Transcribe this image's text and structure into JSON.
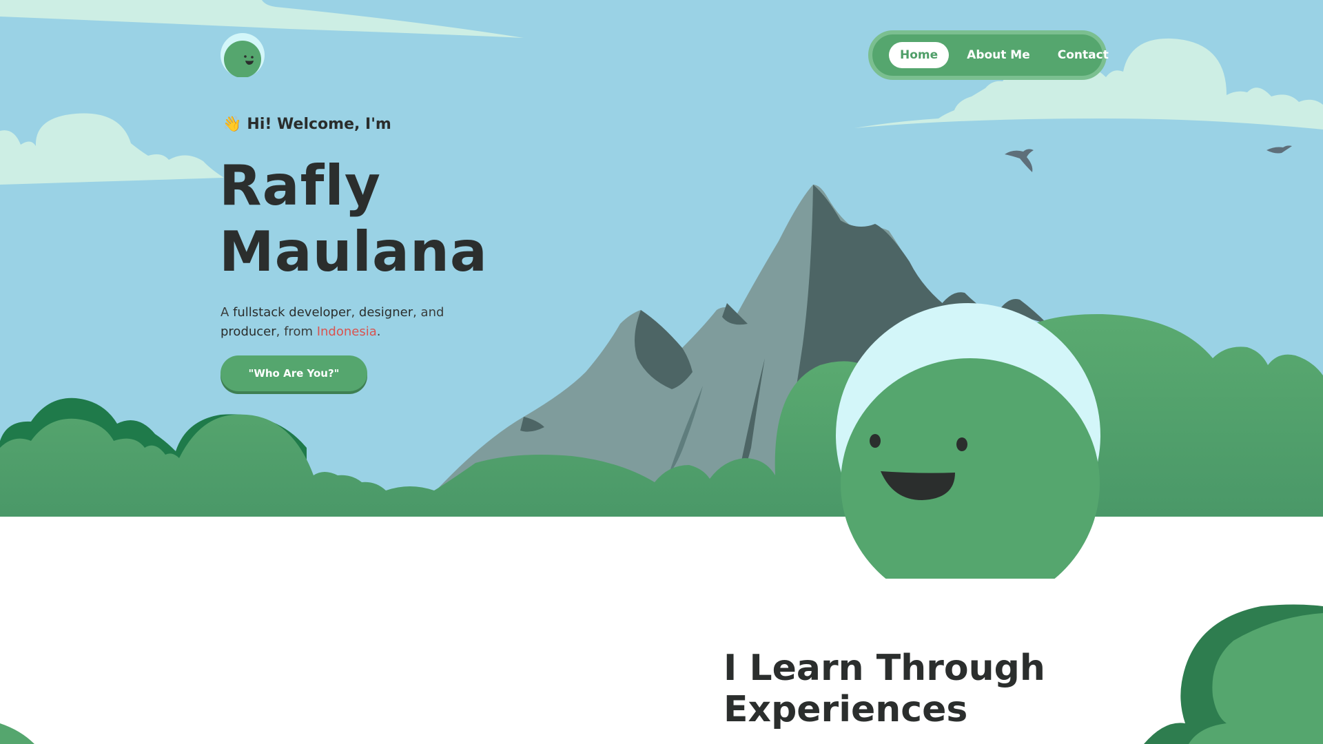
{
  "nav": {
    "items": [
      {
        "label": "Home",
        "active": true
      },
      {
        "label": "About Me",
        "active": false
      },
      {
        "label": "Contact",
        "active": false
      }
    ]
  },
  "logo": {
    "icon": "smiley-blob-icon"
  },
  "hero": {
    "greeting_icon": "👋",
    "greeting": "Hi! Welcome, I'm",
    "name_line1": "Rafly",
    "name_line2": "Maulana",
    "desc": {
      "p1": "A ",
      "s1": "fullstack developer",
      "p2": ", ",
      "s2": "designer",
      "p3": ", and ",
      "s3": "producer",
      "p4": ", from ",
      "country": "Indonesia",
      "p5": "."
    },
    "cta_label": "\"Who Are You?\""
  },
  "section": {
    "title_line1": "I Learn Through",
    "title_line2": "Experiences"
  },
  "colors": {
    "sky": "#9ad2e5",
    "cloud": "#cdeee4",
    "grass": "#55a66e",
    "grass_dark": "#2e7d4f",
    "mountain": "#7f9c9c",
    "mountain_shadow": "#4d6565",
    "text_dark": "#2b2e2d",
    "accent_red": "#d9534f"
  }
}
